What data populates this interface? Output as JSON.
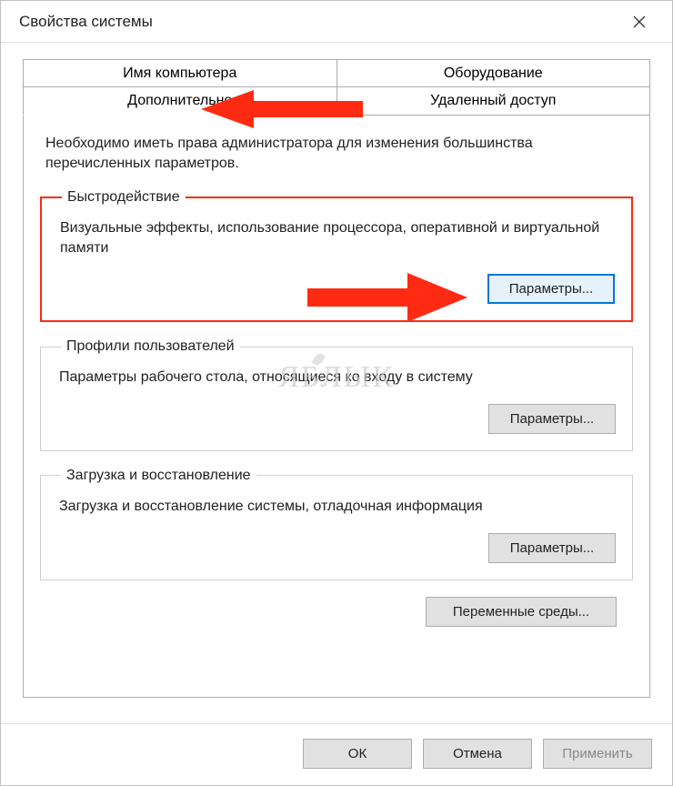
{
  "window": {
    "title": "Свойства системы"
  },
  "tabs": {
    "row1": [
      "Имя компьютера",
      "Оборудование"
    ],
    "row2": [
      "Дополнительно",
      "Удаленный доступ"
    ],
    "active": "Дополнительно"
  },
  "panel": {
    "intro": "Необходимо иметь права администратора для изменения большинства перечисленных параметров."
  },
  "groups": {
    "performance": {
      "legend": "Быстродействие",
      "desc": "Визуальные эффекты, использование процессора, оперативной и виртуальной памяти",
      "button": "Параметры..."
    },
    "profiles": {
      "legend": "Профили пользователей",
      "desc": "Параметры рабочего стола, относящиеся ко входу в систему",
      "button": "Параметры..."
    },
    "startup": {
      "legend": "Загрузка и восстановление",
      "desc": "Загрузка и восстановление системы, отладочная информация",
      "button": "Параметры..."
    }
  },
  "env_button": "Переменные среды...",
  "buttons": {
    "ok": "ОК",
    "cancel": "Отмена",
    "apply": "Применить"
  },
  "watermark": "ЯБЛЫК",
  "annotation": {
    "color": "#ff2a12"
  }
}
